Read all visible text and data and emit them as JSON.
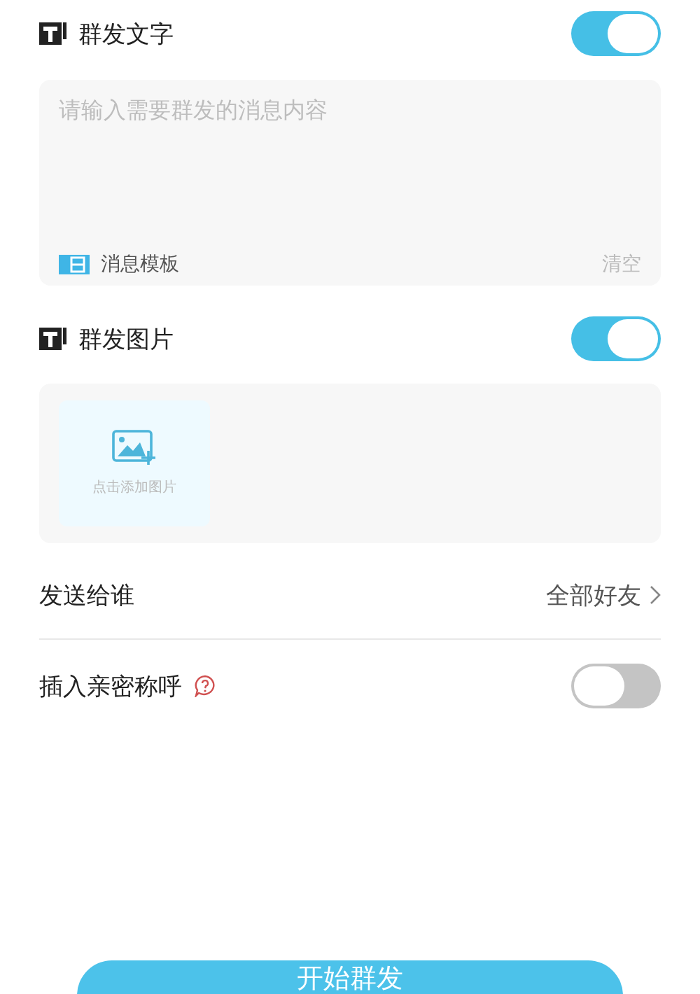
{
  "text_section": {
    "title": "群发文字",
    "on": true,
    "placeholder": "请输入需要群发的消息内容",
    "template_label": "消息模板",
    "clear_label": "清空"
  },
  "image_section": {
    "title": "群发图片",
    "on": true,
    "add_label": "点击添加图片"
  },
  "send_to": {
    "label": "发送给谁",
    "value": "全部好友"
  },
  "nickname": {
    "label": "插入亲密称呼",
    "on": false
  },
  "start_button": "开始群发"
}
